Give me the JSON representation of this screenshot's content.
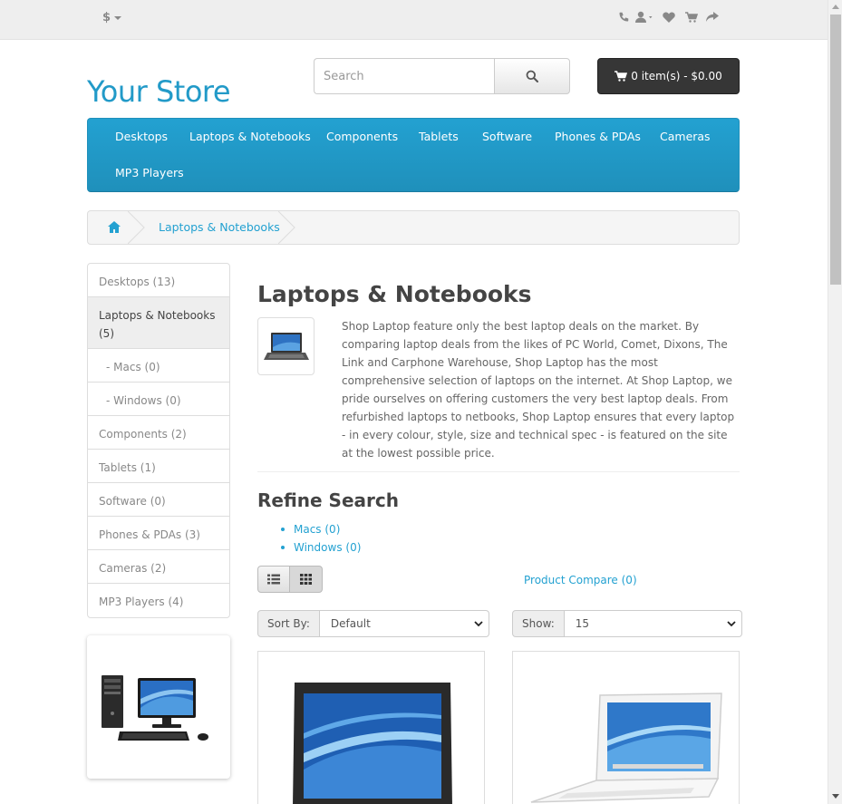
{
  "topbar": {
    "currency": "$"
  },
  "header": {
    "store_name": "Your Store",
    "search_placeholder": "Search",
    "cart_label": "0 item(s) - $0.00"
  },
  "menu": {
    "items": [
      "Desktops",
      "Laptops & Notebooks",
      "Components",
      "Tablets",
      "Software",
      "Phones & PDAs",
      "Cameras",
      "MP3 Players"
    ]
  },
  "breadcrumb": {
    "current": "Laptops & Notebooks"
  },
  "sidebar": {
    "categories": [
      "Desktops (13)",
      "Laptops & Notebooks (5)",
      "- Macs (0)",
      "- Windows (0)",
      "Components (2)",
      "Tablets (1)",
      "Software (0)",
      "Phones & PDAs (3)",
      "Cameras (2)",
      "MP3 Players (4)"
    ]
  },
  "category": {
    "title": "Laptops & Notebooks",
    "description": "Shop Laptop feature only the best laptop deals on the market. By comparing laptop deals from the likes of PC World, Comet, Dixons, The Link and Carphone Warehouse, Shop Laptop has the most comprehensive selection of laptops on the internet. At Shop Laptop, we pride ourselves on offering customers the very best laptop deals. From refurbished laptops to netbooks, Shop Laptop ensures that every laptop - in every colour, style, size and technical spec - is featured on the site at the lowest possible price."
  },
  "refine": {
    "title": "Refine Search",
    "items": [
      "Macs (0)",
      "Windows (0)"
    ]
  },
  "toolbar": {
    "compare_label": "Product Compare (0)",
    "sort_label": "Sort By:",
    "sort_value": "Default",
    "show_label": "Show:",
    "show_value": "15"
  },
  "colors": {
    "accent": "#229ac8",
    "menu": "#229ac8",
    "cart": "#363636"
  }
}
